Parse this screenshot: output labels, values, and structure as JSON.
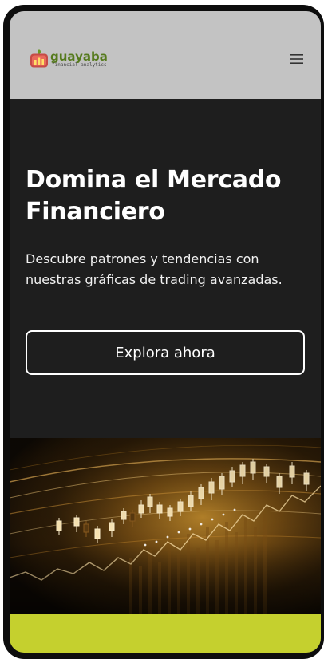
{
  "brand": {
    "name": "guayaba",
    "tagline": "financial analytics",
    "logo_icon": "bar-chart-logo-icon",
    "colors": {
      "name": "#557a1c",
      "mark_fill": "#d9534f",
      "leaf": "#6a9a22"
    }
  },
  "header": {
    "menu_icon": "hamburger-menu-icon",
    "background": "#c3c3c3"
  },
  "hero": {
    "title": "Domina el Mercado Financiero",
    "subtitle": "Descubre patrones y tendencias con nuestras gráficas de trading avanzadas.",
    "cta_label": "Explora ahora",
    "background": "#1e1e1e"
  },
  "image": {
    "subject": "trading-chart-photo",
    "tone": "#c8902e"
  },
  "footer_band": {
    "color": "#c5d02e"
  }
}
